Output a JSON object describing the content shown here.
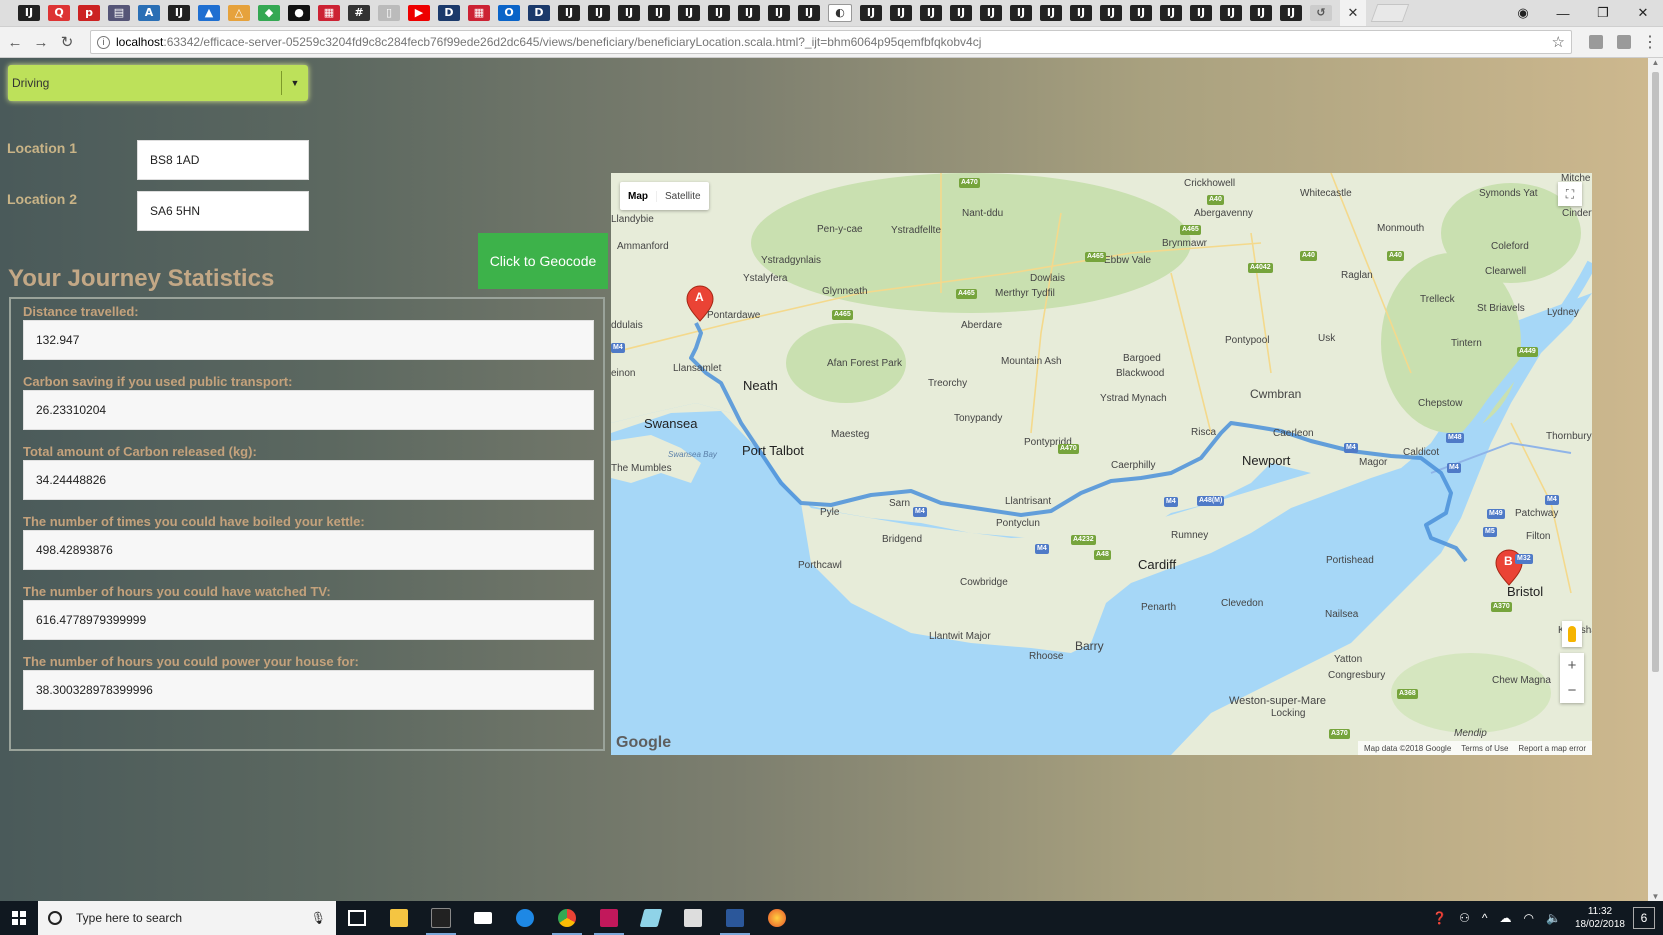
{
  "browser": {
    "url_host": "localhost",
    "url_path": ":63342/efficace-server-05259c3204fd9c8c284fecb76f99ede26d2dc645/views/beneficiary/beneficiaryLocation.scala.html?_ijt=bhm6064p95qemfbfqkobv4cj"
  },
  "form": {
    "mode_selected": "Driving",
    "location1_label": "Location 1",
    "location1_value": "BS8 1AD",
    "location2_label": "Location 2",
    "location2_value": "SA6 5HN",
    "geocode_button": "Click to Geocode"
  },
  "stats": {
    "title": "Your Journey Statistics",
    "items": [
      {
        "label": "Distance travelled:",
        "value": "132.947"
      },
      {
        "label": "Carbon saving if you used public transport:",
        "value": "26.23310204"
      },
      {
        "label": "Total amount of Carbon released (kg):",
        "value": "34.24448826"
      },
      {
        "label": "The number of times you could have boiled your kettle:",
        "value": "498.42893876"
      },
      {
        "label": "The number of hours you could have watched TV:",
        "value": "616.4778979399999"
      },
      {
        "label": "The number of hours you could power your house for:",
        "value": "38.300328978399996"
      }
    ]
  },
  "map": {
    "type_map": "Map",
    "type_satellite": "Satellite",
    "marker_a": "A",
    "marker_b": "B",
    "google_logo": "Google",
    "attribution": {
      "data": "Map data ©2018 Google",
      "terms": "Terms of Use",
      "report": "Report a map error"
    },
    "places": {
      "swansea": "Swansea",
      "neath": "Neath",
      "port_talbot": "Port Talbot",
      "newport": "Newport",
      "cardiff": "Cardiff",
      "bristol": "Bristol",
      "cwmbran": "Cwmbran",
      "barry": "Barry",
      "bridgend": "Bridgend",
      "pontypool": "Pontypool",
      "aberdare": "Aberdare",
      "merthyr": "Merthyr Tydfil",
      "caerphilly": "Caerphilly",
      "pontypridd": "Pontypridd",
      "penarth": "Penarth",
      "clevedon": "Clevedon",
      "portishead": "Portishead",
      "weston": "Weston-super-Mare",
      "chepstow": "Chepstow",
      "monmouth": "Monmouth",
      "abergavenny": "Abergavenny",
      "ammanford": "Ammanford",
      "pontardawe": "Pontardawe",
      "llansamlet": "Llansamlet",
      "maesteg": "Maesteg",
      "afan": "Afan Forest Park",
      "tonypandy": "Tonypandy",
      "porthcawl": "Porthcawl",
      "pyle": "Pyle",
      "cowbridge": "Cowbridge",
      "llantwit": "Llantwit Major",
      "rhoose": "Rhoose",
      "rumney": "Rumney",
      "caerleon": "Caerleon",
      "magor": "Magor",
      "caldicot": "Caldicot",
      "usk": "Usk",
      "raglan": "Raglan",
      "thornbury": "Thornbury",
      "patchway": "Patchway",
      "filton": "Filton",
      "nailsea": "Nailsea",
      "yatton": "Yatton",
      "congresbury": "Congresbury",
      "locking": "Locking",
      "chew_magna": "Chew Magna",
      "keynsham": "Keynsham",
      "mendip": "Mendip",
      "blackwood": "Blackwood",
      "bargoed": "Bargoed",
      "ystrad": "Ystrad Mynach",
      "risca": "Risca",
      "llantrisant": "Llantrisant",
      "pontyclun": "Pontyclun",
      "mountain_ash": "Mountain Ash",
      "treorchy": "Treorchy",
      "glynneath": "Glynneath",
      "ystalyfera": "Ystalyfera",
      "ystradgynlais": "Ystradgynlais",
      "crickhowell": "Crickhowell",
      "whitecastle": "Whitecastle",
      "nant_ddu": "Nant-ddu",
      "brynmawr": "Brynmawr",
      "ebbw_vale": "Ebbw Vale",
      "dowlais": "Dowlais",
      "sam": "Sarn",
      "the_mumbles": "The Mumbles",
      "swansea_bay": "Swansea Bay",
      "trelleck": "Trelleck",
      "tintern": "Tintern",
      "st_briavels": "St Briavels",
      "lydney": "Lydney",
      "clearwell": "Clearwell",
      "coleford": "Coleford",
      "symonds_yat": "Symonds Yat",
      "cinderford": "Cinderf",
      "mitcheldean": "Mitche",
      "pen_y_cae": "Pen-y-cae",
      "ystradfellte": "Ystradfellte",
      "llandybie": "Llandybie",
      "ddulais": "ddulais",
      "einon": "einon"
    }
  },
  "taskbar": {
    "search_placeholder": "Type here to search",
    "time": "11:32",
    "date": "18/02/2018",
    "notifications": "6"
  }
}
